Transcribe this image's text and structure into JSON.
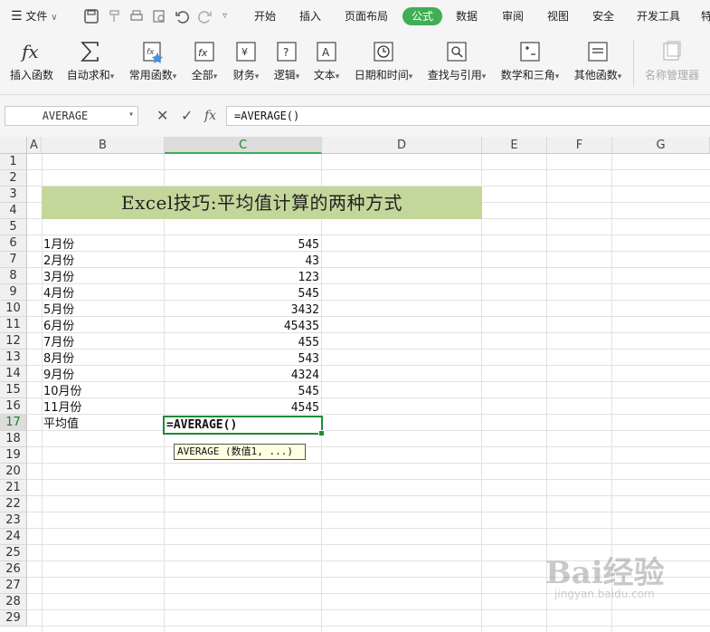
{
  "menubar": {
    "file": "文件",
    "tabs": [
      {
        "label": "开始"
      },
      {
        "label": "插入"
      },
      {
        "label": "页面布局"
      },
      {
        "label": "公式",
        "active": true
      },
      {
        "label": "数据"
      },
      {
        "label": "审阅"
      },
      {
        "label": "视图"
      },
      {
        "label": "安全"
      },
      {
        "label": "开发工具"
      },
      {
        "label": "特"
      }
    ],
    "accent_color": "#3fae54"
  },
  "ribbon": {
    "buttons": [
      {
        "label": "插入函数",
        "icon": "fx-icon"
      },
      {
        "label": "自动求和",
        "icon": "sigma-icon",
        "dropdown": true
      },
      {
        "label": "常用函数",
        "icon": "star-function-icon",
        "dropdown": true
      },
      {
        "label": "全部",
        "icon": "function-box-icon",
        "dropdown": true
      },
      {
        "label": "财务",
        "icon": "yen-icon",
        "dropdown": true
      },
      {
        "label": "逻辑",
        "icon": "question-icon",
        "dropdown": true
      },
      {
        "label": "文本",
        "icon": "text-a-icon",
        "dropdown": true
      },
      {
        "label": "日期和时间",
        "icon": "clock-icon",
        "dropdown": true
      },
      {
        "label": "查找与引用",
        "icon": "search-doc-icon",
        "dropdown": true
      },
      {
        "label": "数学和三角",
        "icon": "math-icon",
        "dropdown": true
      },
      {
        "label": "其他函数",
        "icon": "more-functions-icon",
        "dropdown": true
      },
      {
        "label": "名称管理器",
        "icon": "name-manager-icon",
        "disabled": true
      }
    ]
  },
  "formula_bar": {
    "name_box": "AVERAGE",
    "formula": "=AVERAGE()",
    "cancel_symbol": "✕",
    "confirm_symbol": "✓",
    "fx_symbol": "fx"
  },
  "grid": {
    "columns": [
      "A",
      "B",
      "C",
      "D",
      "E",
      "F",
      "G"
    ],
    "selected_column": "C",
    "rows": [
      "1",
      "2",
      "3",
      "4",
      "5",
      "6",
      "7",
      "8",
      "9",
      "10",
      "11",
      "12",
      "13",
      "14",
      "15",
      "16",
      "17",
      "18",
      "19",
      "20",
      "21",
      "22",
      "23",
      "24",
      "25",
      "26",
      "27",
      "28",
      "29"
    ],
    "selected_row": "17",
    "title": "Excel技巧:平均值计算的两种方式",
    "title_band_color": "#c4d79b",
    "data": [
      {
        "month": "1月份",
        "value": "545"
      },
      {
        "month": "2月份",
        "value": "43"
      },
      {
        "month": "3月份",
        "value": "123"
      },
      {
        "month": "4月份",
        "value": "545"
      },
      {
        "month": "5月份",
        "value": "3432"
      },
      {
        "month": "6月份",
        "value": "45435"
      },
      {
        "month": "7月份",
        "value": "455"
      },
      {
        "month": "8月份",
        "value": "543"
      },
      {
        "month": "9月份",
        "value": "4324"
      },
      {
        "month": "10月份",
        "value": "545"
      },
      {
        "month": "11月份",
        "value": "4545"
      }
    ],
    "average_label": "平均值",
    "active_cell_text": "=AVERAGE()",
    "tooltip": "AVERAGE (数值1, ...)"
  },
  "watermark": {
    "logo": "Bai经验",
    "url": "jingyan.baidu.com"
  }
}
